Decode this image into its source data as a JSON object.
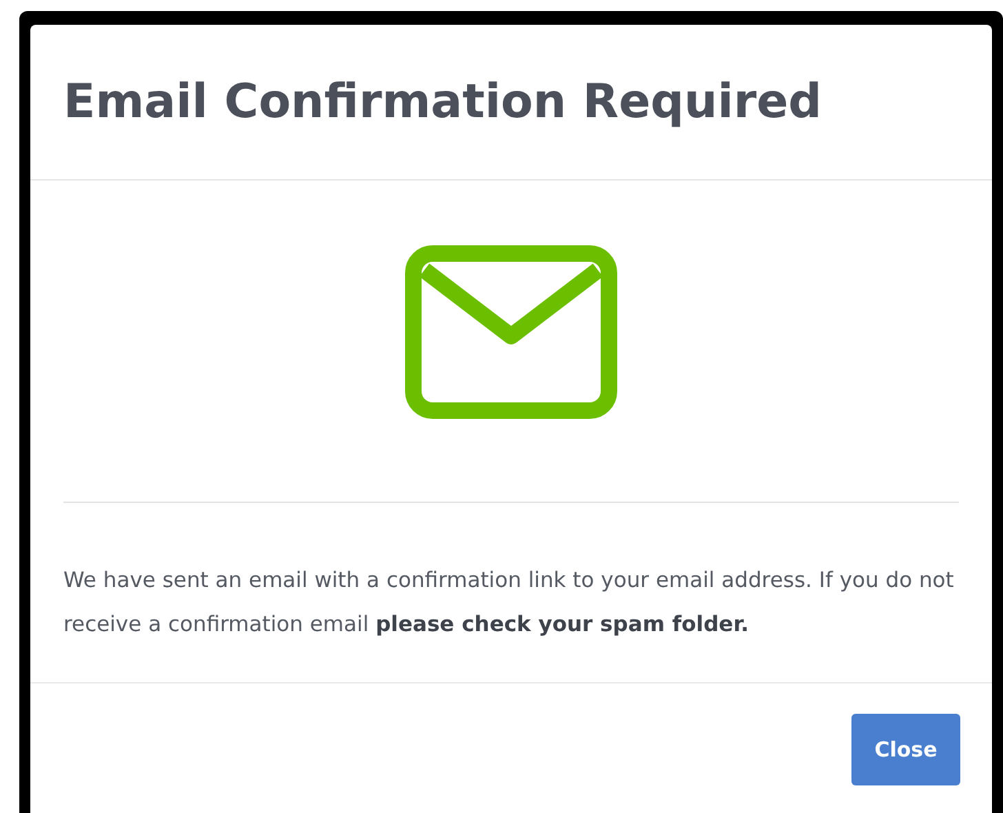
{
  "dialog": {
    "title": "Email Confirmation Required",
    "message": "We have sent an email with a confirmation link to your email address. If you do not receive a confirmation email **please check your spam folder.**",
    "buttons": [
      "Close"
    ]
  }
}
